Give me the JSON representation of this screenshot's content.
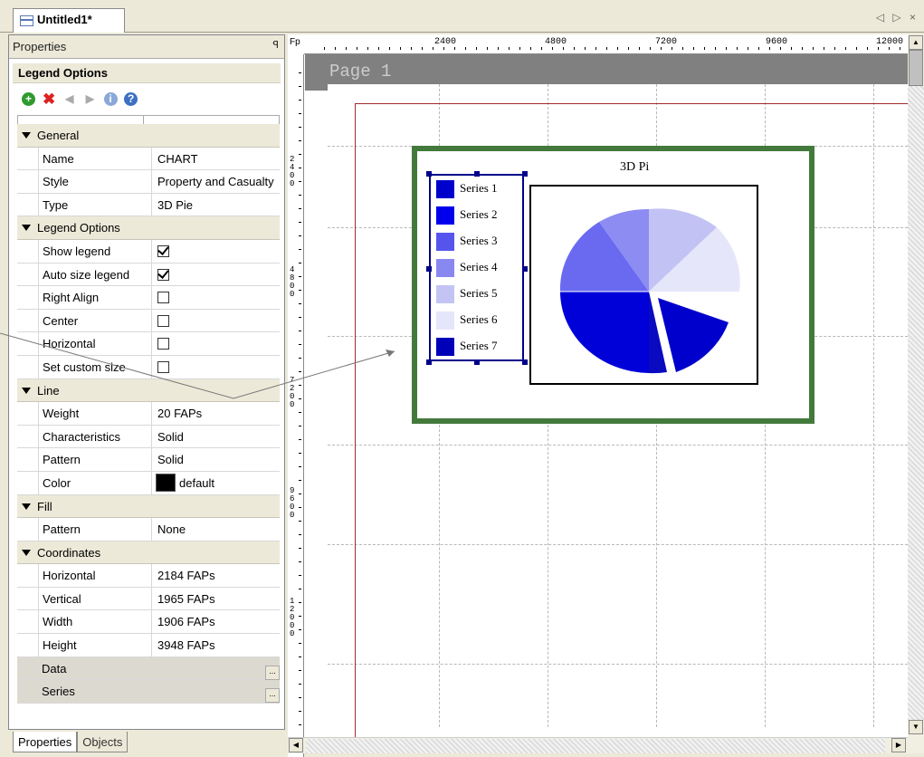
{
  "doc_tab": {
    "title": "Untitled1*",
    "controls": "◁ ▷ ×"
  },
  "properties_panel": {
    "title": "Properties",
    "pin": "ꟼ",
    "section_title": "Legend Options",
    "rows": [
      {
        "kind": "category",
        "label": "General"
      },
      {
        "kind": "prop",
        "name": "Name",
        "value": "CHART"
      },
      {
        "kind": "prop",
        "name": "Style",
        "value": "Property and Casualty"
      },
      {
        "kind": "prop",
        "name": "Type",
        "value": "3D Pie"
      },
      {
        "kind": "category",
        "label": "Legend Options"
      },
      {
        "kind": "check",
        "name": "Show legend",
        "checked": true
      },
      {
        "kind": "check",
        "name": "Auto size legend",
        "checked": true
      },
      {
        "kind": "check",
        "name": "Right Align",
        "checked": false
      },
      {
        "kind": "check",
        "name": "Center",
        "checked": false
      },
      {
        "kind": "check",
        "name": "Horizontal",
        "checked": false
      },
      {
        "kind": "check",
        "name": "Set custom size",
        "checked": false
      },
      {
        "kind": "category",
        "label": "Line"
      },
      {
        "kind": "prop",
        "name": "Weight",
        "value": "20 FAPs"
      },
      {
        "kind": "prop",
        "name": "Characteristics",
        "value": "Solid"
      },
      {
        "kind": "prop",
        "name": "Pattern",
        "value": "Solid"
      },
      {
        "kind": "color",
        "name": "Color",
        "value": "default",
        "swatch": "#000000"
      },
      {
        "kind": "category",
        "label": "Fill"
      },
      {
        "kind": "prop",
        "name": "Pattern",
        "value": "None"
      },
      {
        "kind": "category",
        "label": "Coordinates"
      },
      {
        "kind": "prop",
        "name": "Horizontal",
        "value": "2184 FAPs"
      },
      {
        "kind": "prop",
        "name": "Vertical",
        "value": "1965 FAPs"
      },
      {
        "kind": "prop",
        "name": "Width",
        "value": "1906 FAPs"
      },
      {
        "kind": "prop",
        "name": "Height",
        "value": "3948 FAPs"
      },
      {
        "kind": "ellipsis",
        "name": "Data"
      },
      {
        "kind": "ellipsis",
        "name": "Series"
      }
    ]
  },
  "bottom_tabs": [
    "Properties",
    "Objects"
  ],
  "ruler": {
    "unit": "Fp",
    "top_ticks": [
      "2400",
      "4800",
      "7200",
      "9600",
      "12000"
    ],
    "left_ticks": [
      "2400",
      "4800",
      "7200",
      "9600",
      "12000"
    ]
  },
  "page_label": "Page 1",
  "chart": {
    "title": "3D Pi",
    "legend": [
      {
        "label": "Series 1",
        "color": "#0000cc"
      },
      {
        "label": "Series 2",
        "color": "#0000ee"
      },
      {
        "label": "Series 3",
        "color": "#5555ee"
      },
      {
        "label": "Series 4",
        "color": "#8888f0"
      },
      {
        "label": "Series 5",
        "color": "#c4c4f4"
      },
      {
        "label": "Series 6",
        "color": "#e6e6fb"
      },
      {
        "label": "Series 7",
        "color": "#0000b8"
      }
    ]
  },
  "colors": {
    "accent_green": "#437a3c",
    "selection": "#00008b",
    "margin": "#a12a2a"
  }
}
